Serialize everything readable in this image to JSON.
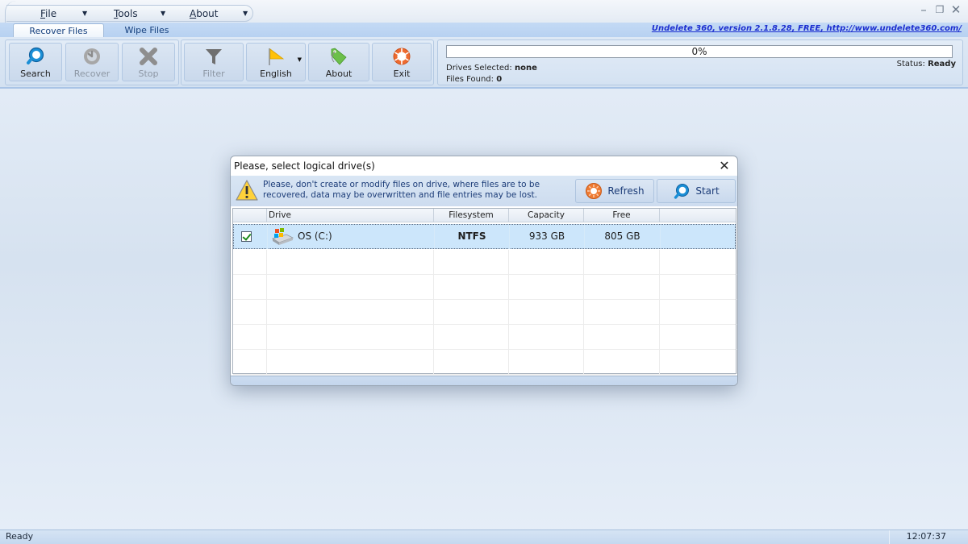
{
  "menu": {
    "file": "File",
    "tools": "Tools",
    "about": "About"
  },
  "window_controls": {
    "minimize": "–",
    "restore": "❐",
    "close": "✕"
  },
  "tabs": [
    {
      "label": "Recover Files",
      "active": true
    },
    {
      "label": "Wipe Files",
      "active": false
    }
  ],
  "version_link": "Undelete 360, version 2.1.8.28, FREE, http://www.undelete360.com/",
  "ribbon": {
    "buttons": [
      {
        "label": "Search",
        "icon": "search-icon",
        "enabled": true
      },
      {
        "label": "Recover",
        "icon": "recover-icon",
        "enabled": false
      },
      {
        "label": "Stop",
        "icon": "stop-icon",
        "enabled": false
      },
      {
        "label": "Filter",
        "icon": "filter-icon",
        "enabled": false
      },
      {
        "label": "English",
        "icon": "flag-icon",
        "enabled": true,
        "dropdown": true
      },
      {
        "label": "About",
        "icon": "tag-icon",
        "enabled": true
      },
      {
        "label": "Exit",
        "icon": "exit-icon",
        "enabled": true
      }
    ]
  },
  "status_panel": {
    "progress_text": "0%",
    "progress_value": 0,
    "drives_selected_label": "Drives Selected:",
    "drives_selected_value": "none",
    "files_found_label": "Files Found:",
    "files_found_value": "0",
    "status_label": "Status:",
    "status_value": "Ready"
  },
  "dialog": {
    "title": "Please, select logical drive(s)",
    "close": "✕",
    "warning": "Please, don't create or modify files on drive, where files are to be recovered, data may be overwritten and file entries may be lost.",
    "refresh_label": "Refresh",
    "start_label": "Start",
    "columns": [
      "",
      "Drive",
      "Filesystem",
      "Capacity",
      "Free",
      ""
    ],
    "rows": [
      {
        "checked": true,
        "drive": "OS (C:)",
        "filesystem": "NTFS",
        "capacity": "933 GB",
        "free": "805 GB"
      }
    ]
  },
  "statusbar": {
    "text": "Ready",
    "time": "12:07:37"
  }
}
